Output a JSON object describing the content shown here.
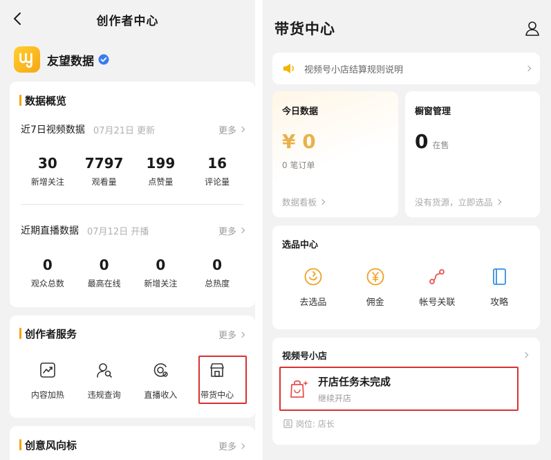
{
  "left": {
    "header": {
      "title": "创作者中心"
    },
    "profile": {
      "name": "友望数据"
    },
    "overview": {
      "title": "数据概览",
      "video": {
        "label": "近7日视频数据",
        "date": "07月21日 更新",
        "more": "更多",
        "stats": [
          {
            "value": "30",
            "label": "新增关注"
          },
          {
            "value": "7797",
            "label": "观看量"
          },
          {
            "value": "199",
            "label": "点赞量"
          },
          {
            "value": "16",
            "label": "评论量"
          }
        ]
      },
      "live": {
        "label": "近期直播数据",
        "date": "07月12日 开播",
        "more": "更多",
        "stats": [
          {
            "value": "0",
            "label": "观众总数"
          },
          {
            "value": "0",
            "label": "最高在线"
          },
          {
            "value": "0",
            "label": "新增关注"
          },
          {
            "value": "0",
            "label": "总热度"
          }
        ]
      }
    },
    "services": {
      "title": "创作者服务",
      "more": "更多",
      "items": [
        {
          "label": "内容加热",
          "icon": "trend-chart-icon"
        },
        {
          "label": "违规查询",
          "icon": "person-search-icon"
        },
        {
          "label": "直播收入",
          "icon": "live-income-icon"
        },
        {
          "label": "带货中心",
          "icon": "store-icon"
        }
      ]
    },
    "trends": {
      "title": "创意风向标",
      "more": "更多"
    }
  },
  "right": {
    "header": {
      "title": "带货中心"
    },
    "notice": {
      "text": "视频号小店结算规则说明"
    },
    "today": {
      "title": "今日数据",
      "amount": "¥ 0",
      "orders": "0 笔订单",
      "link": "数据看板"
    },
    "showcase": {
      "title": "橱窗管理",
      "count": "0",
      "count_suffix": "在售",
      "link": "没有货源，立即选品"
    },
    "selection": {
      "title": "选品中心",
      "items": [
        {
          "label": "去选品",
          "icon": "pick-products-icon"
        },
        {
          "label": "佣金",
          "icon": "commission-yen-icon"
        },
        {
          "label": "帐号关联",
          "icon": "account-link-icon"
        },
        {
          "label": "攻略",
          "icon": "guide-book-icon"
        }
      ]
    },
    "shop": {
      "title": "视频号小店",
      "task_title": "开店任务未完成",
      "task_sub": "继续开店",
      "position": "岗位: 店长"
    }
  },
  "colors": {
    "accent": "#f2a400",
    "highlight": "#d93030",
    "bg": "#f2f2f2",
    "card": "#ffffff"
  }
}
